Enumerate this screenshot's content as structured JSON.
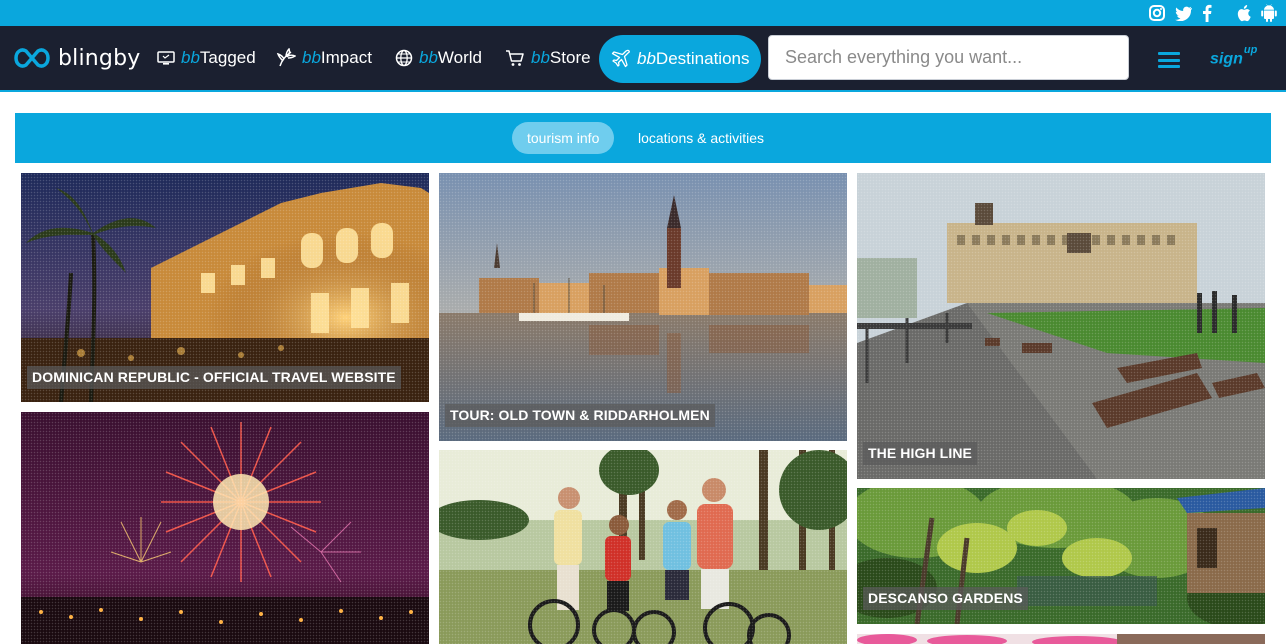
{
  "top_bar": {
    "social_icons": [
      "instagram-icon",
      "twitter-icon",
      "facebook-icon",
      "apple-icon",
      "android-icon"
    ],
    "color": "#0aa7dd"
  },
  "nav": {
    "logo_text": "blingby",
    "items": [
      {
        "prefix": "bb",
        "label": "Tagged",
        "icon": "monitor-icon"
      },
      {
        "prefix": "bb",
        "label": "Impact",
        "icon": "plant-icon"
      },
      {
        "prefix": "bb",
        "label": "World",
        "icon": "globe-icon"
      },
      {
        "prefix": "bb",
        "label": "Store",
        "icon": "cart-icon"
      },
      {
        "prefix": "bb",
        "label": "Destinations",
        "icon": "airplane-icon",
        "active": true
      }
    ],
    "search_placeholder": "Search everything you want...",
    "signup_label": "sign",
    "signup_sup": "up",
    "background": "#1b2030",
    "accent": "#0aa7dd"
  },
  "tabs": [
    {
      "label": "tourism info",
      "active": true
    },
    {
      "label": "locations & activities",
      "active": false
    }
  ],
  "cards": [
    {
      "caption": "DOMINICAN REPUBLIC - OFFICIAL TRAVEL WEBSITE",
      "scene": "night-hotel"
    },
    {
      "caption": "",
      "scene": "fireworks"
    },
    {
      "caption": "TOUR: OLD TOWN & RIDDARHOLMEN",
      "scene": "stockholm-waterfront"
    },
    {
      "caption": "",
      "scene": "family-bikes"
    },
    {
      "caption": "THE HIGH LINE",
      "scene": "elevated-park"
    },
    {
      "caption": "DESCANSO GARDENS",
      "scene": "japanese-garden"
    },
    {
      "caption": "",
      "scene": "pink-blossoms"
    }
  ]
}
